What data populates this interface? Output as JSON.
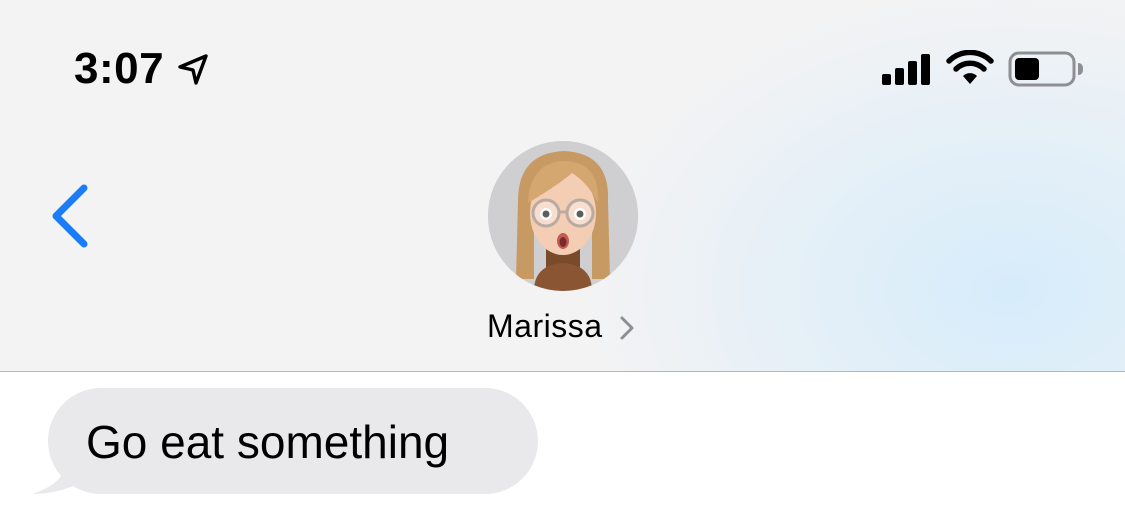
{
  "status_bar": {
    "time": "3:07",
    "icons": [
      "location-arrow-icon",
      "cellular-signal-icon",
      "wifi-icon",
      "battery-icon"
    ]
  },
  "nav": {
    "back_icon": "chevron-left-icon",
    "contact_name": "Marissa",
    "contact_chevron_icon": "chevron-right-icon",
    "accent_color": "#1a7cf6"
  },
  "messages": [
    {
      "direction": "incoming",
      "text": "Go eat something",
      "bubble_color": "#e9e9eb"
    }
  ]
}
